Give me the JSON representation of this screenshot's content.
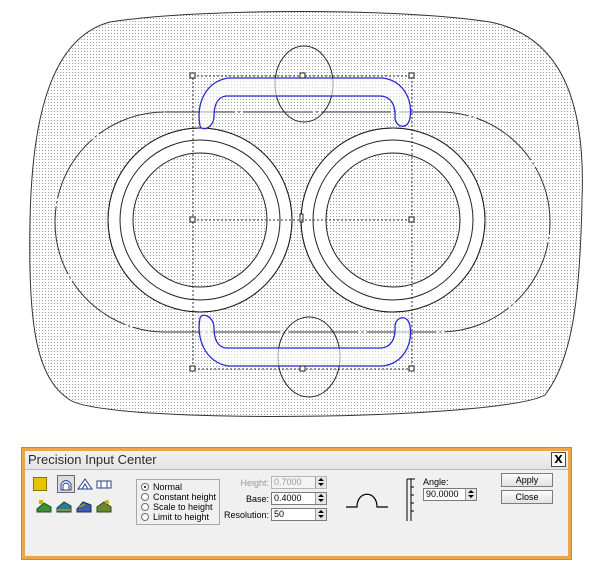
{
  "dialog": {
    "title": "Precision Input Center",
    "close_label": "X",
    "shape_modes": [
      "Normal",
      "Constant height",
      "Scale to height",
      "Limit to height"
    ],
    "selected_mode": "Normal",
    "fields": {
      "height": {
        "label": "Height:",
        "value": "0.7000",
        "enabled": false
      },
      "base": {
        "label": "Base:",
        "value": "0.4000",
        "enabled": true
      },
      "resolution": {
        "label": "Resolution:",
        "value": "50",
        "enabled": true
      },
      "angle": {
        "label": "Angle:",
        "value": "90.0000",
        "enabled": true
      }
    },
    "buttons": {
      "apply": "Apply",
      "close": "Close"
    }
  },
  "colors": {
    "accent_border": "#e9a64a",
    "selection_path": "#2a2ad6",
    "outline": "#222222"
  }
}
